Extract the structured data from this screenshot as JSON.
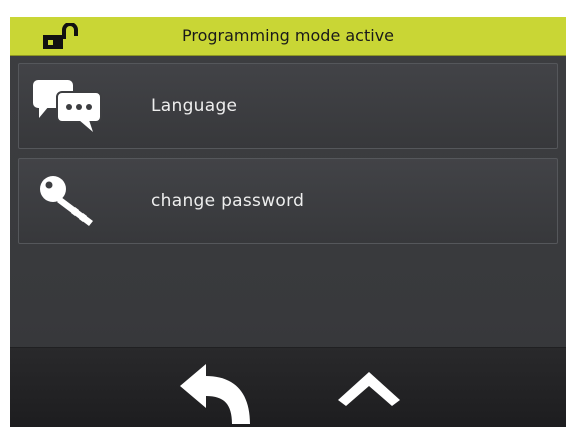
{
  "header": {
    "title": "Programming mode active",
    "background_color": "#c9d635",
    "status_icon": "unlocked-padlock-icon"
  },
  "menu": {
    "items": [
      {
        "label": "Language",
        "icon": "chat-bubbles-icon"
      },
      {
        "label": "change password",
        "icon": "key-icon"
      }
    ]
  },
  "footer": {
    "buttons": [
      {
        "icon": "back-arrow-icon"
      },
      {
        "icon": "chevron-up-icon"
      }
    ]
  }
}
